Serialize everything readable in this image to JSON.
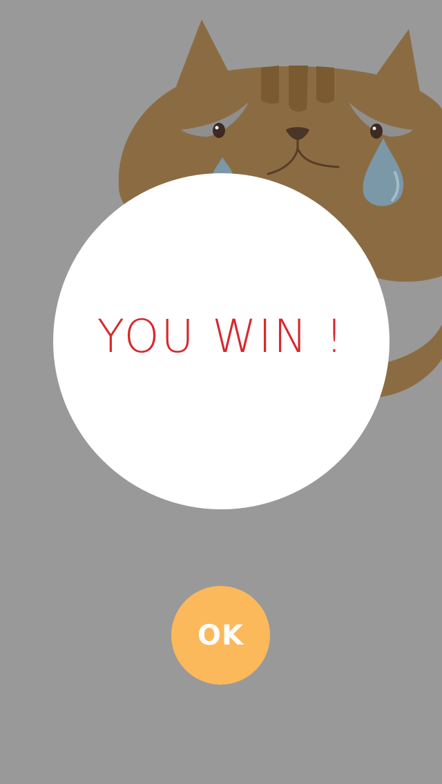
{
  "result": {
    "text": "YOU WIN !"
  },
  "ok_button": {
    "label": "OK"
  },
  "colors": {
    "background": "#999999",
    "result_text": "#d7282e",
    "ok_button": "#fbb95c",
    "cat_fur": "#8b6c42",
    "cat_stripes": "#7a5a31",
    "tear": "#7a98a8"
  }
}
